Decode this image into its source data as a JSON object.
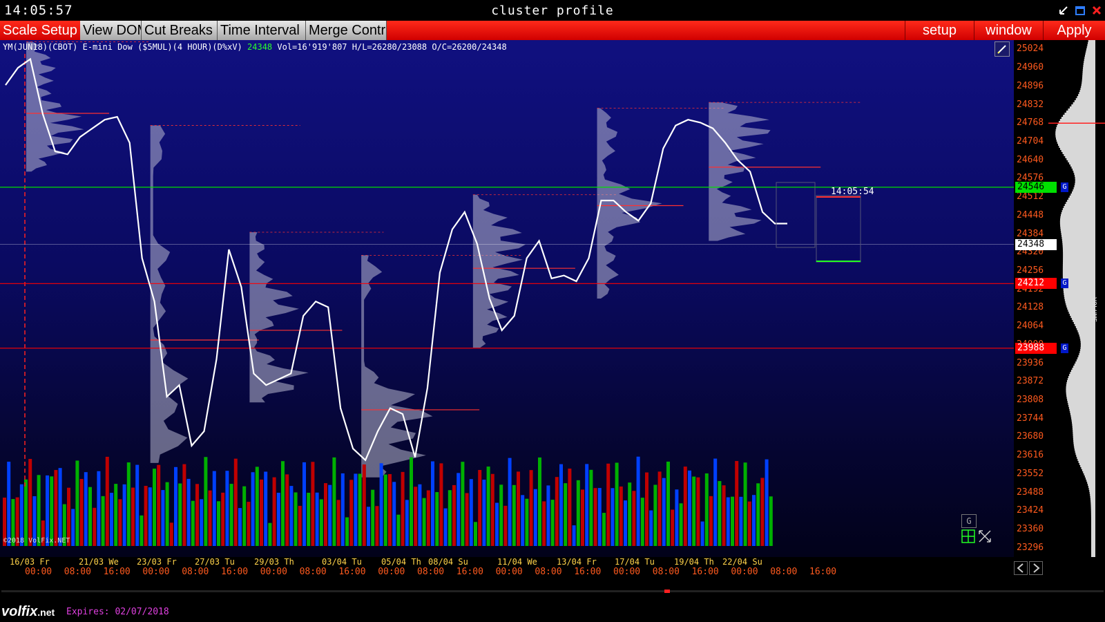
{
  "window": {
    "clock": "14:05:57",
    "title": "cluster profile"
  },
  "toolbar": {
    "left": [
      "Scale Setup",
      "View DOM",
      "Cut Breaks",
      "Time Interval",
      "Merge Contr"
    ],
    "right": [
      "setup",
      "window",
      "Apply"
    ]
  },
  "chart_info": {
    "symbol": "YM(JUN18)(CBOT) E-mini Dow ($5MUL)(4 HOUR)(D%xV)",
    "last": "24348",
    "rest": "Vol=16'919'807 H/L=26280/23088 O/C=26200/24348"
  },
  "copyright": "©2018 VolFix.NET",
  "live_time": "14:05:54",
  "y_axis": {
    "ticks": [
      "25024",
      "24960",
      "24896",
      "24832",
      "24768",
      "24704",
      "24640",
      "24576",
      "24512",
      "24448",
      "24384",
      "24320",
      "24256",
      "24192",
      "24128",
      "24064",
      "24000",
      "23936",
      "23872",
      "23808",
      "23744",
      "23680",
      "23616",
      "23552",
      "23488",
      "23424",
      "23360",
      "23296"
    ],
    "min": 23264,
    "max": 25056,
    "levels": [
      {
        "price": "24546",
        "color": "#00e000",
        "text_color": "#000",
        "tag": "G"
      },
      {
        "price": "24212",
        "color": "#ff0000",
        "text_color": "#ffffff",
        "tag": "G"
      },
      {
        "price": "23988",
        "color": "#ff0000",
        "text_color": "#ffffff",
        "tag": "G"
      },
      {
        "price": "24348",
        "color": "#ffffff",
        "text_color": "#000000",
        "tag": ""
      }
    ]
  },
  "x_axis": {
    "dates": [
      "16/03 Fr",
      "21/03 We",
      "23/03 Fr",
      "27/03 Tu",
      "29/03 Th",
      "03/04 Tu",
      "05/04 Th",
      "08/04 Su",
      "11/04 We",
      "13/04 Fr",
      "17/04 Tu",
      "19/04 Th",
      "22/04 Su"
    ],
    "times": [
      "00:00",
      "08:00",
      "16:00",
      "00:00",
      "08:00",
      "16:00",
      "00:00",
      "08:00",
      "16:00",
      "00:00",
      "08:00",
      "16:00",
      "00:00",
      "08:00",
      "16:00",
      "00:00",
      "08:00",
      "16:00",
      "00:00",
      "08:00",
      "16:00"
    ]
  },
  "volume_panel_label": "VOLUME",
  "status": {
    "logo": "volfix",
    "logo_suffix": ".net",
    "expires": "Expires: 02/07/2018"
  },
  "icons": {
    "edit": "pencil-icon",
    "minimize": "minimize-icon",
    "maximize": "maximize-icon",
    "close": "close-icon",
    "g_button": "g-icon",
    "grid": "grid-icon",
    "expand": "expand-icon",
    "scroll_left": "chevron-left-icon",
    "scroll_right": "chevron-right-icon"
  },
  "chart_data": {
    "type": "line",
    "title": "",
    "ylim": [
      23264,
      25056
    ],
    "series": [
      {
        "values": [
          24900,
          24960,
          24990,
          24800,
          24670,
          24660,
          24720,
          24750,
          24780,
          24790,
          24700,
          24300,
          24150,
          23820,
          23860,
          23650,
          23700,
          23950,
          24330,
          24200,
          23900,
          23860,
          23880,
          23900,
          24100,
          24150,
          24130,
          23780,
          23640,
          23600,
          23700,
          23780,
          23760,
          23610,
          23850,
          24250,
          24400,
          24460,
          24350,
          24160,
          24050,
          24100,
          24300,
          24360,
          24230,
          24240,
          24220,
          24300,
          24500,
          24500,
          24460,
          24430,
          24490,
          24680,
          24760,
          24780,
          24770,
          24750,
          24700,
          24640,
          24600,
          24460,
          24420,
          24420
        ]
      }
    ]
  }
}
